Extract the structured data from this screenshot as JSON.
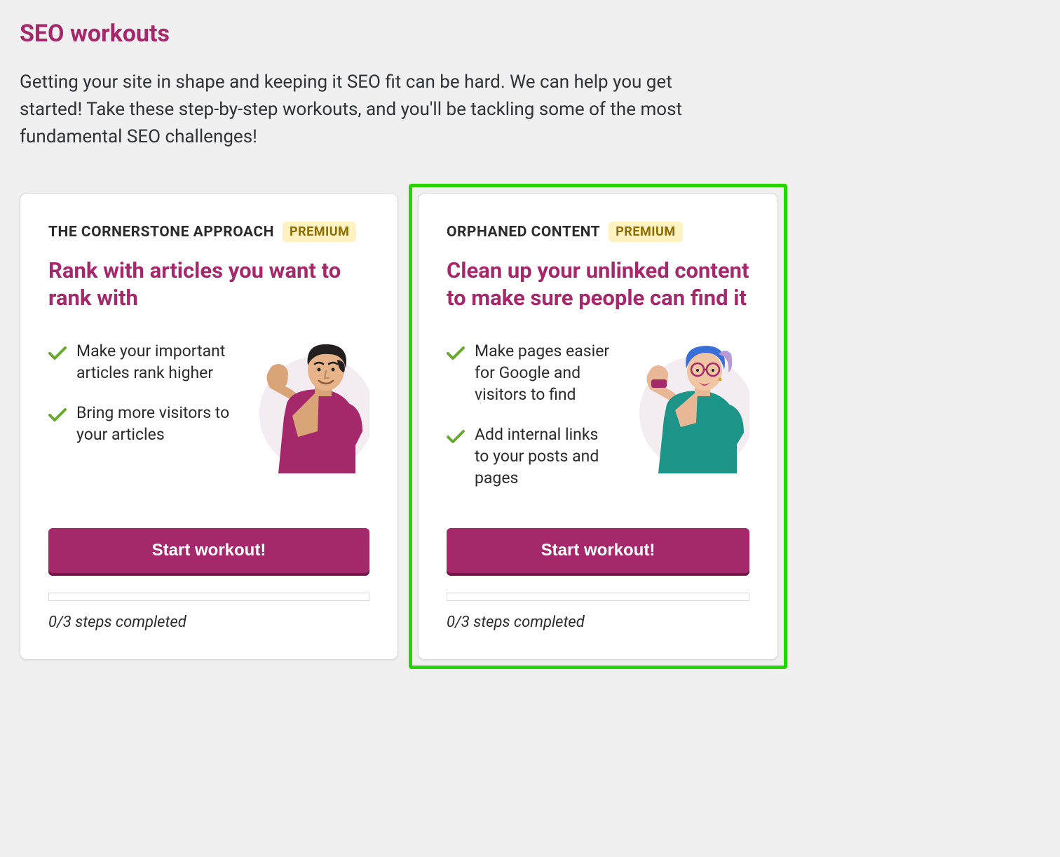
{
  "page": {
    "title": "SEO workouts",
    "intro": "Getting your site in shape and keeping it SEO fit can be hard. We can help you get started! Take these step-by-step workouts, and you'll be tackling some of the most fundamental SEO challenges!"
  },
  "premium_label": "PREMIUM",
  "cards": [
    {
      "eyebrow": "THE CORNERSTONE APPROACH",
      "title": "Rank with articles you want to rank with",
      "bullets": [
        "Make your important articles rank higher",
        "Bring more visitors to your articles"
      ],
      "button": "Start workout!",
      "steps": "0/3 steps completed",
      "highlighted": false
    },
    {
      "eyebrow": "ORPHANED CONTENT",
      "title": "Clean up your unlinked content to make sure people can find it",
      "bullets": [
        "Make pages easier for Google and visitors to find",
        "Add internal links to your posts and pages"
      ],
      "button": "Start workout!",
      "steps": "0/3 steps completed",
      "highlighted": true
    }
  ]
}
